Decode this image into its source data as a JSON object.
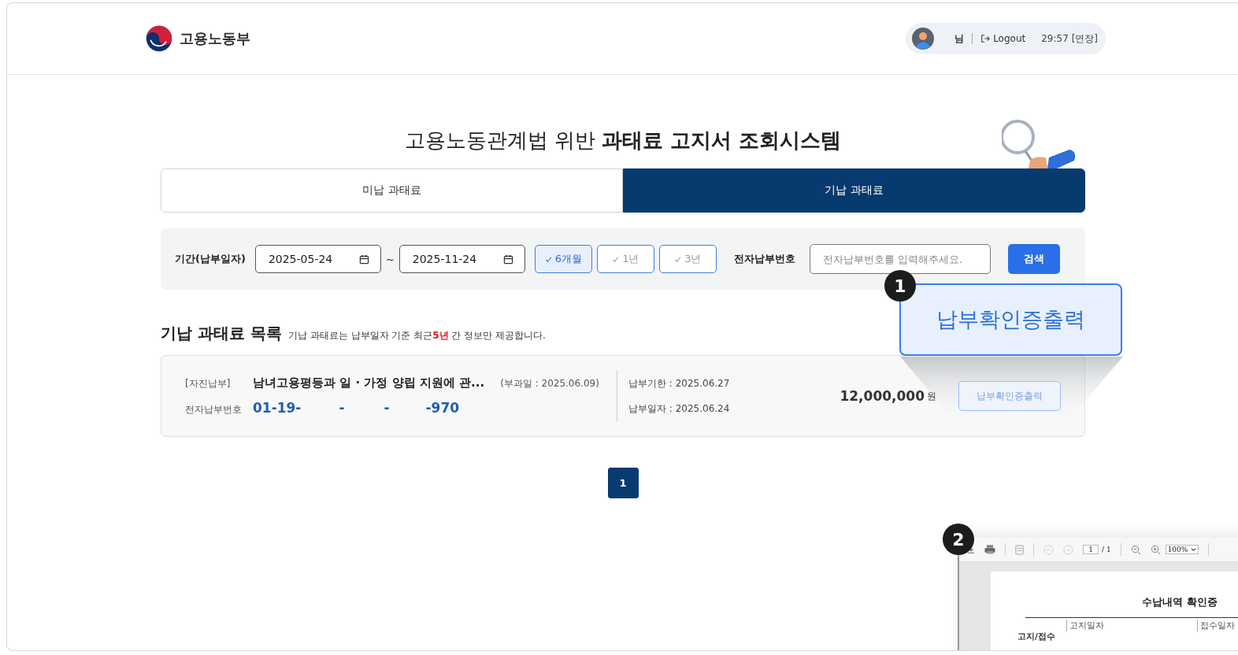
{
  "header": {
    "logo_text": "고용노동부",
    "user": {
      "name": "님",
      "logout": "Logout",
      "timer": "29:57 [연장]"
    }
  },
  "title": "고용노동관계법 위반 **과태료 고지서 조회시스템**",
  "tabs": [
    {
      "label": "미납 과태료",
      "selected": false
    },
    {
      "label": "기납 과태료",
      "selected": true
    }
  ],
  "filter": {
    "period_label": "기간(납부일자)",
    "start": "2025-05-24",
    "separator": "~",
    "end": "2025-11-24",
    "ranges": [
      {
        "label": "6개월",
        "selected": true
      },
      {
        "label": "1년",
        "selected": false
      },
      {
        "label": "3년",
        "selected": false
      }
    ],
    "number_label": "전자납부번호",
    "number_placeholder": "전자납부번호를 입력해주세요.",
    "search_button": "검색"
  },
  "list": {
    "title": "기납 과태료 목록",
    "note": "기납 과태료는 납부일자 기준 최근**5년** 간 정보만 제공합니다.",
    "items": [
      {
        "type": "[자진납부]",
        "title": "남녀고용평등과 일 · 가정 양립 지원에 관...",
        "levy_date": "(부과일 : 2025.06.09)",
        "number_label": "전자납부번호",
        "number_parts": [
          "01-19-",
          "-",
          "-",
          "-970"
        ],
        "due": "납부기한 : 2025.06.27",
        "paid": "납부일자 : 2025.06.24",
        "amount": "12,000,000",
        "unit": "원",
        "button": "납부확인증출력"
      }
    ]
  },
  "pagination": [
    {
      "label": "1",
      "selected": true
    }
  ],
  "annotations": [
    {
      "number": "1",
      "zoom_label": "납부확인증출력"
    },
    {
      "number": "2"
    }
  ],
  "pdf_preview": {
    "page": "1",
    "page_total": "/ 1",
    "zoom": "100%",
    "doc_title": "수납내역 확인증",
    "cells": [
      "고지/접수",
      "고지일자",
      "접수일자"
    ]
  }
}
